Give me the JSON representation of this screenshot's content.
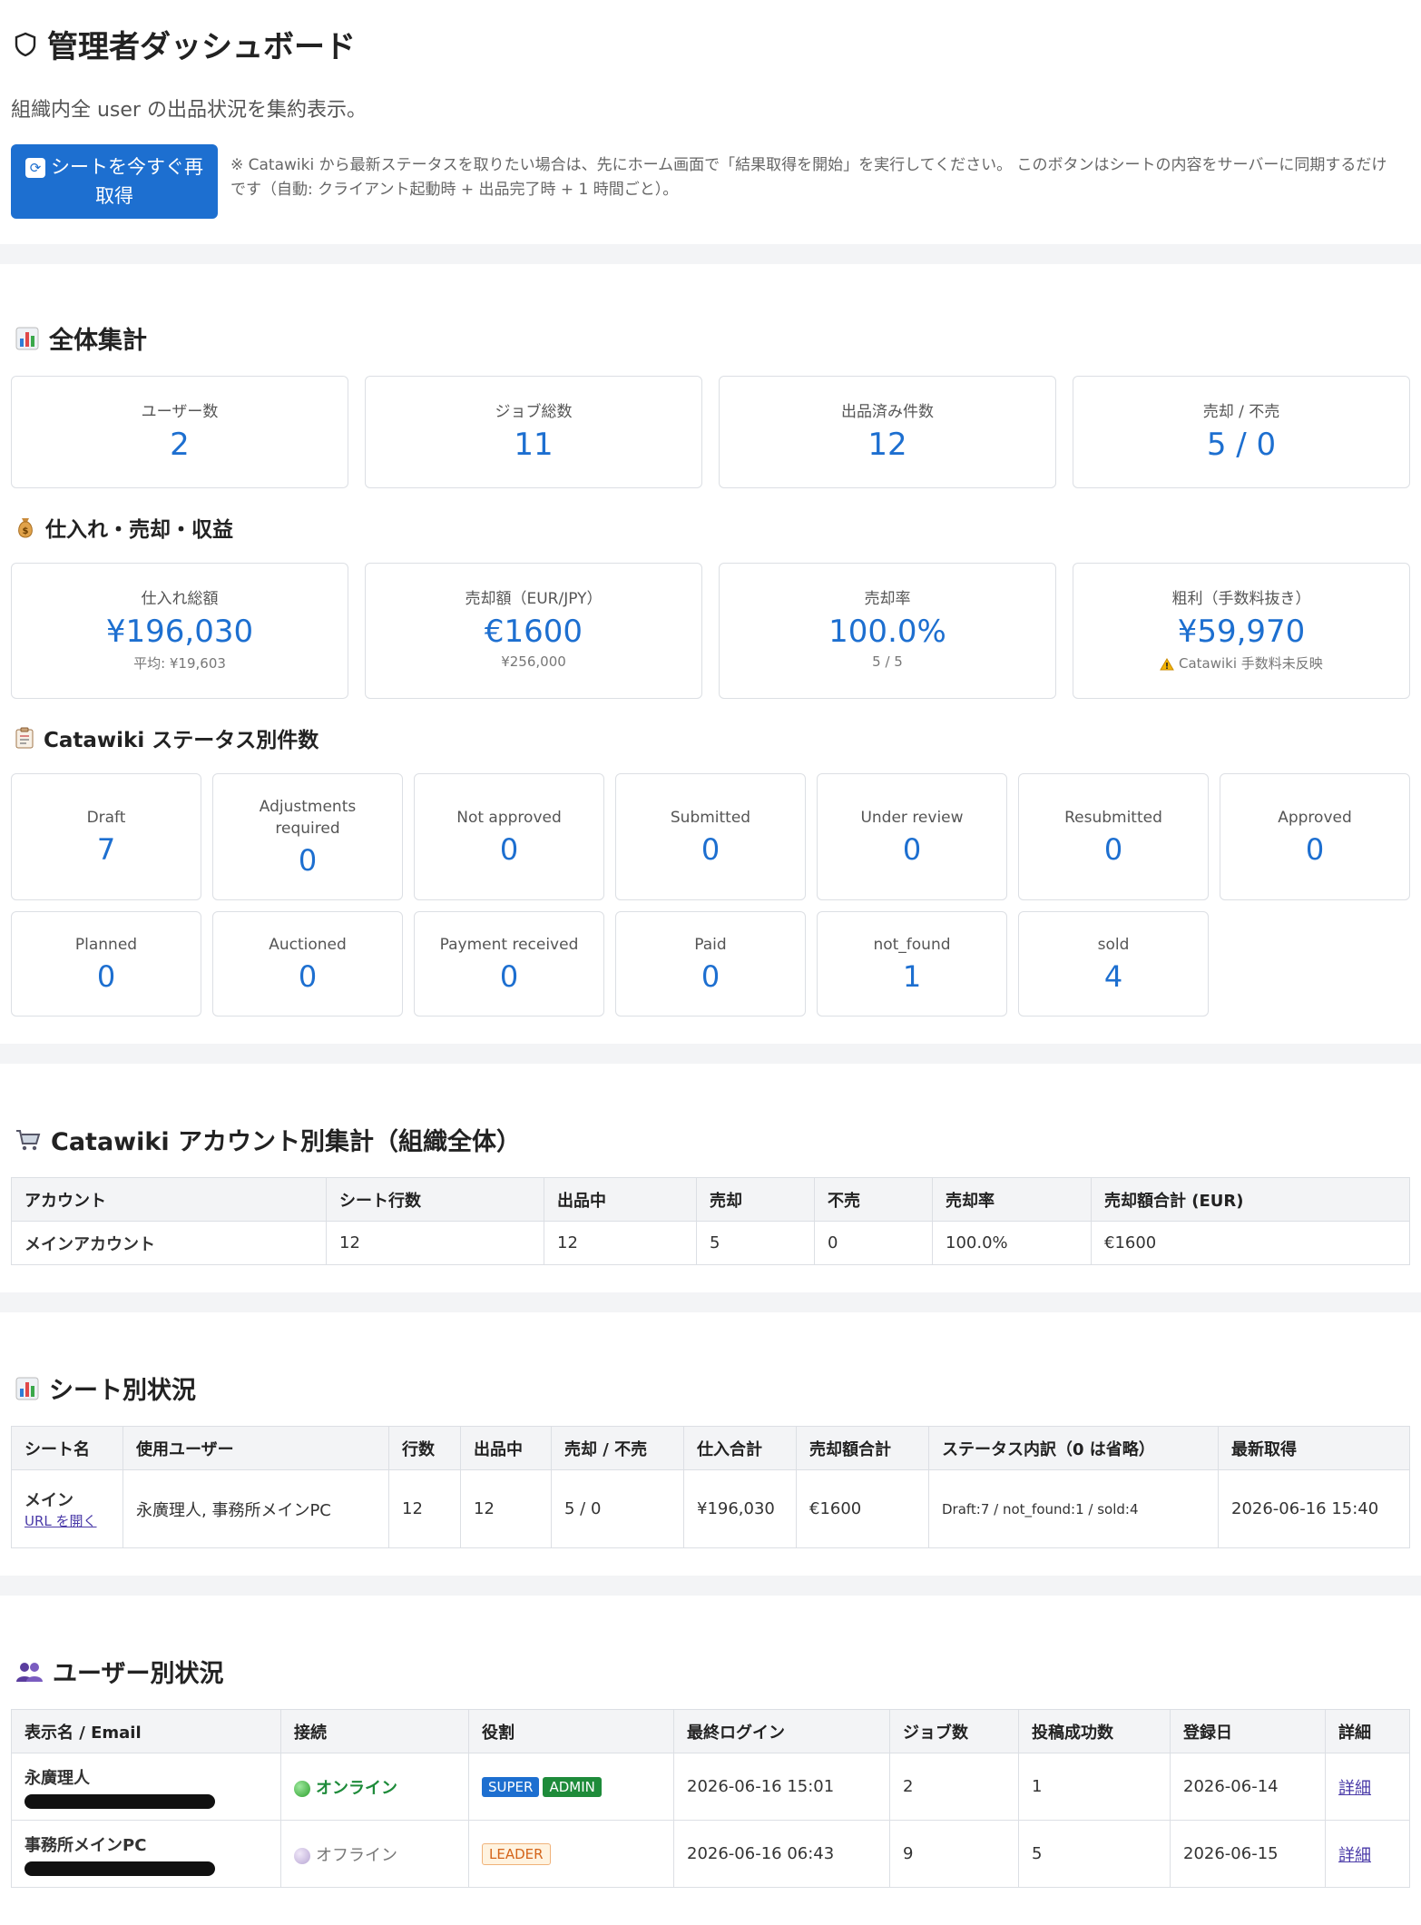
{
  "header": {
    "title": "管理者ダッシュボード",
    "subtitle": "組織内全 user の出品状況を集約表示。",
    "refresh_label": "シートを今すぐ再取得",
    "refresh_note": "※ Catawiki から最新ステータスを取りたい場合は、先にホーム画面で「結果取得を開始」を実行してください。 このボタンはシートの内容をサーバーに同期するだけです（自動: クライアント起動時 + 出品完了時 + 1 時間ごと）。"
  },
  "overall": {
    "title": "全体集計",
    "cards": [
      {
        "label": "ユーザー数",
        "value": "2"
      },
      {
        "label": "ジョブ総数",
        "value": "11"
      },
      {
        "label": "出品済み件数",
        "value": "12"
      },
      {
        "label": "売却 / 不売",
        "value": "5 / 0"
      }
    ]
  },
  "finance": {
    "title": "仕入れ・売却・収益",
    "cards": [
      {
        "label": "仕入れ総額",
        "value": "¥196,030",
        "sub": "平均: ¥19,603"
      },
      {
        "label": "売却額（EUR/JPY）",
        "value": "€1600",
        "sub": "¥256,000"
      },
      {
        "label": "売却率",
        "value": "100.0%",
        "sub": "5 / 5"
      },
      {
        "label": "粗利（手数料抜き）",
        "value": "¥59,970",
        "sub": "Catawiki 手数料未反映"
      }
    ]
  },
  "status": {
    "title": "Catawiki ステータス別件数",
    "row1": [
      {
        "label": "Draft",
        "value": "7"
      },
      {
        "label": "Adjustments required",
        "value": "0"
      },
      {
        "label": "Not approved",
        "value": "0"
      },
      {
        "label": "Submitted",
        "value": "0"
      },
      {
        "label": "Under review",
        "value": "0"
      },
      {
        "label": "Resubmitted",
        "value": "0"
      },
      {
        "label": "Approved",
        "value": "0"
      }
    ],
    "row2": [
      {
        "label": "Planned",
        "value": "0"
      },
      {
        "label": "Auctioned",
        "value": "0"
      },
      {
        "label": "Payment received",
        "value": "0"
      },
      {
        "label": "Paid",
        "value": "0"
      },
      {
        "label": "not_found",
        "value": "1"
      },
      {
        "label": "sold",
        "value": "4"
      }
    ]
  },
  "accounts": {
    "title": "Catawiki アカウント別集計（組織全体）",
    "headers": [
      "アカウント",
      "シート行数",
      "出品中",
      "売却",
      "不売",
      "売却率",
      "売却額合計 (EUR)"
    ],
    "rows": [
      [
        "メインアカウント",
        "12",
        "12",
        "5",
        "0",
        "100.0%",
        "€1600"
      ]
    ]
  },
  "sheets": {
    "title": "シート別状況",
    "headers": [
      "シート名",
      "使用ユーザー",
      "行数",
      "出品中",
      "売却 / 不売",
      "仕入合計",
      "売却額合計",
      "ステータス内訳（0 は省略）",
      "最新取得"
    ],
    "rows": [
      {
        "name": "メイン",
        "link": "URL を開く",
        "users": "永廣理人, 事務所メインPC",
        "rows": "12",
        "listed": "12",
        "sold": "5 / 0",
        "cost": "¥196,030",
        "sales": "€1600",
        "breakdown": "Draft:7 / not_found:1 / sold:4",
        "updated": "2026-06-16 15:40"
      }
    ]
  },
  "users": {
    "title": "ユーザー別状況",
    "headers": [
      "表示名 / Email",
      "接続",
      "役割",
      "最終ログイン",
      "ジョブ数",
      "投稿成功数",
      "登録日",
      "詳細"
    ],
    "rows": [
      {
        "name": "永廣理人",
        "status": "オンライン",
        "roles": [
          "SUPER",
          "ADMIN"
        ],
        "last_login": "2026-06-16 15:01",
        "jobs": "2",
        "success": "1",
        "registered": "2026-06-14",
        "detail": "詳細"
      },
      {
        "name": "事務所メインPC",
        "status": "オフライン",
        "roles": [
          "LEADER"
        ],
        "last_login": "2026-06-16 06:43",
        "jobs": "9",
        "success": "5",
        "registered": "2026-06-15",
        "detail": "詳細"
      }
    ]
  }
}
